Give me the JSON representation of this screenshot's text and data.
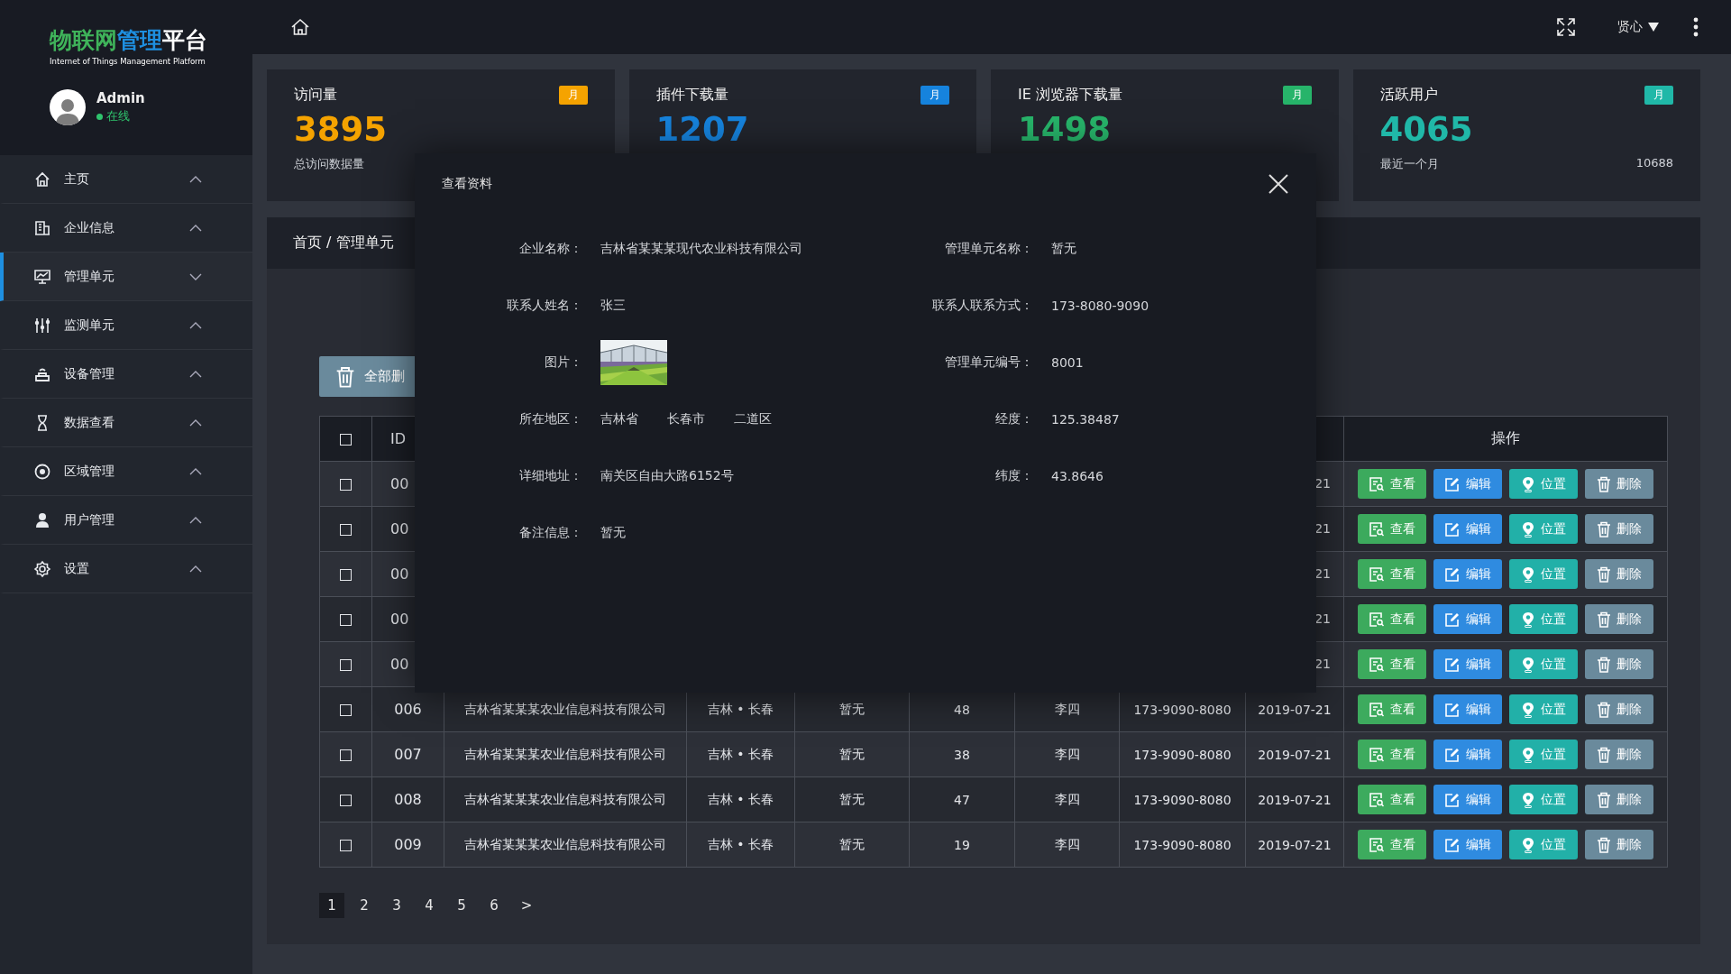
{
  "sidebar": {
    "logo": {
      "parts": [
        {
          "text": "物联网",
          "color": "#3fb35a"
        },
        {
          "text": "管理",
          "color": "#1e8fe0"
        },
        {
          "text": "平台",
          "color": "#ffffff"
        }
      ],
      "subtitle": "Internet of Things Management Platform"
    },
    "user": {
      "name": "Admin",
      "status": "在线",
      "online": true
    },
    "menu": [
      {
        "label": "主页",
        "selected": false
      },
      {
        "label": "企业信息",
        "selected": false
      },
      {
        "label": "管理单元",
        "selected": true
      },
      {
        "label": "监测单元",
        "selected": false
      },
      {
        "label": "设备管理",
        "selected": false
      },
      {
        "label": "数据查看",
        "selected": false
      },
      {
        "label": "区域管理",
        "selected": false
      },
      {
        "label": "用户管理",
        "selected": false
      },
      {
        "label": "设置",
        "selected": false
      }
    ]
  },
  "topbar": {
    "user": "贤心"
  },
  "stats": [
    {
      "title": "访问量",
      "badge": "月",
      "color": "#f5a300",
      "value": "3895",
      "subtitle": "总访问数据量"
    },
    {
      "title": "插件下载量",
      "badge": "月",
      "color": "#1683dd",
      "value": "1207"
    },
    {
      "title": "IE 浏览器下载量",
      "badge": "月",
      "color": "#27b46a",
      "value": "1498"
    },
    {
      "title": "活跃用户",
      "badge": "月",
      "color": "#20b8a8",
      "value": "4065",
      "subtitle": "最近一个月",
      "extra": "10688"
    }
  ],
  "breadcrumb": "首页 / 管理单元",
  "toolbar": {
    "delete_all": "全部删"
  },
  "table": {
    "header_checkbox": {
      "checked": false
    },
    "id_header": "ID",
    "actions_header": "操作",
    "rows": [
      {
        "checked": false,
        "id": "00",
        "date": "21",
        "actions": [
          {
            "label": "查看",
            "kind": "view"
          },
          {
            "label": "编辑",
            "kind": "edit"
          },
          {
            "label": "位置",
            "kind": "locate"
          },
          {
            "label": "删除",
            "kind": "delete"
          }
        ]
      },
      {
        "checked": false,
        "id": "00",
        "date": "21",
        "actions": [
          {
            "label": "查看",
            "kind": "view"
          },
          {
            "label": "编辑",
            "kind": "edit"
          },
          {
            "label": "位置",
            "kind": "locate"
          },
          {
            "label": "删除",
            "kind": "delete"
          }
        ]
      },
      {
        "checked": false,
        "id": "00",
        "date": "21",
        "actions": [
          {
            "label": "查看",
            "kind": "view"
          },
          {
            "label": "编辑",
            "kind": "edit"
          },
          {
            "label": "位置",
            "kind": "locate"
          },
          {
            "label": "删除",
            "kind": "delete"
          }
        ]
      },
      {
        "checked": false,
        "id": "00",
        "date": "21",
        "actions": [
          {
            "label": "查看",
            "kind": "view"
          },
          {
            "label": "编辑",
            "kind": "edit"
          },
          {
            "label": "位置",
            "kind": "locate"
          },
          {
            "label": "删除",
            "kind": "delete"
          }
        ]
      },
      {
        "checked": false,
        "id": "00",
        "date": "21",
        "actions": [
          {
            "label": "查看",
            "kind": "view"
          },
          {
            "label": "编辑",
            "kind": "edit"
          },
          {
            "label": "位置",
            "kind": "locate"
          },
          {
            "label": "删除",
            "kind": "delete"
          }
        ]
      },
      {
        "checked": false,
        "id": "006",
        "company": "吉林省某某某农业信息科技有限公司",
        "region": "吉林 • 长春",
        "unit_name": "暂无",
        "unit_no": "48",
        "contact": "李四",
        "phone": "173-9090-8080",
        "date": "2019-07-21",
        "actions": [
          {
            "label": "查看",
            "kind": "view"
          },
          {
            "label": "编辑",
            "kind": "edit"
          },
          {
            "label": "位置",
            "kind": "locate"
          },
          {
            "label": "删除",
            "kind": "delete"
          }
        ]
      },
      {
        "checked": false,
        "id": "007",
        "company": "吉林省某某某农业信息科技有限公司",
        "region": "吉林 • 长春",
        "unit_name": "暂无",
        "unit_no": "38",
        "contact": "李四",
        "phone": "173-9090-8080",
        "date": "2019-07-21",
        "actions": [
          {
            "label": "查看",
            "kind": "view"
          },
          {
            "label": "编辑",
            "kind": "edit"
          },
          {
            "label": "位置",
            "kind": "locate"
          },
          {
            "label": "删除",
            "kind": "delete"
          }
        ]
      },
      {
        "checked": false,
        "id": "008",
        "company": "吉林省某某某农业信息科技有限公司",
        "region": "吉林 • 长春",
        "unit_name": "暂无",
        "unit_no": "47",
        "contact": "李四",
        "phone": "173-9090-8080",
        "date": "2019-07-21",
        "actions": [
          {
            "label": "查看",
            "kind": "view"
          },
          {
            "label": "编辑",
            "kind": "edit"
          },
          {
            "label": "位置",
            "kind": "locate"
          },
          {
            "label": "删除",
            "kind": "delete"
          }
        ]
      },
      {
        "checked": false,
        "id": "009",
        "company": "吉林省某某某农业信息科技有限公司",
        "region": "吉林 • 长春",
        "unit_name": "暂无",
        "unit_no": "19",
        "contact": "李四",
        "phone": "173-9090-8080",
        "date": "2019-07-21",
        "actions": [
          {
            "label": "查看",
            "kind": "view"
          },
          {
            "label": "编辑",
            "kind": "edit"
          },
          {
            "label": "位置",
            "kind": "locate"
          },
          {
            "label": "删除",
            "kind": "delete"
          }
        ]
      }
    ]
  },
  "pagination": [
    {
      "label": "1",
      "selected": true
    },
    {
      "label": "2",
      "selected": false
    },
    {
      "label": "3",
      "selected": false
    },
    {
      "label": "4",
      "selected": false
    },
    {
      "label": "5",
      "selected": false
    },
    {
      "label": "6",
      "selected": false
    },
    {
      "label": ">",
      "selected": false
    }
  ],
  "modal": {
    "title": "查看资料",
    "fields": [
      {
        "label": "企业名称：",
        "kind": "text",
        "value": "吉林省某某某现代农业科技有限公司"
      },
      {
        "label": "管理单元名称：",
        "kind": "text",
        "value": "暂无"
      },
      {
        "label": "联系人姓名：",
        "kind": "text",
        "value": "张三"
      },
      {
        "label": "联系人联系方式：",
        "kind": "text",
        "value": "173-8080-9090"
      },
      {
        "label": "图片：",
        "kind": "picture"
      },
      {
        "label": "管理单元编号：",
        "kind": "text",
        "value": "8001"
      },
      {
        "label": "所在地区：",
        "kind": "multi",
        "values": [
          "吉林省",
          "长春市",
          "二道区"
        ]
      },
      {
        "label": "经度：",
        "kind": "text",
        "value": "125.38487"
      },
      {
        "label": "详细地址：",
        "kind": "text",
        "value": "南关区自由大路6152号"
      },
      {
        "label": "纬度：",
        "kind": "text",
        "value": "43.8646"
      },
      {
        "label": "备注信息：",
        "kind": "text",
        "value": "暂无"
      }
    ]
  }
}
